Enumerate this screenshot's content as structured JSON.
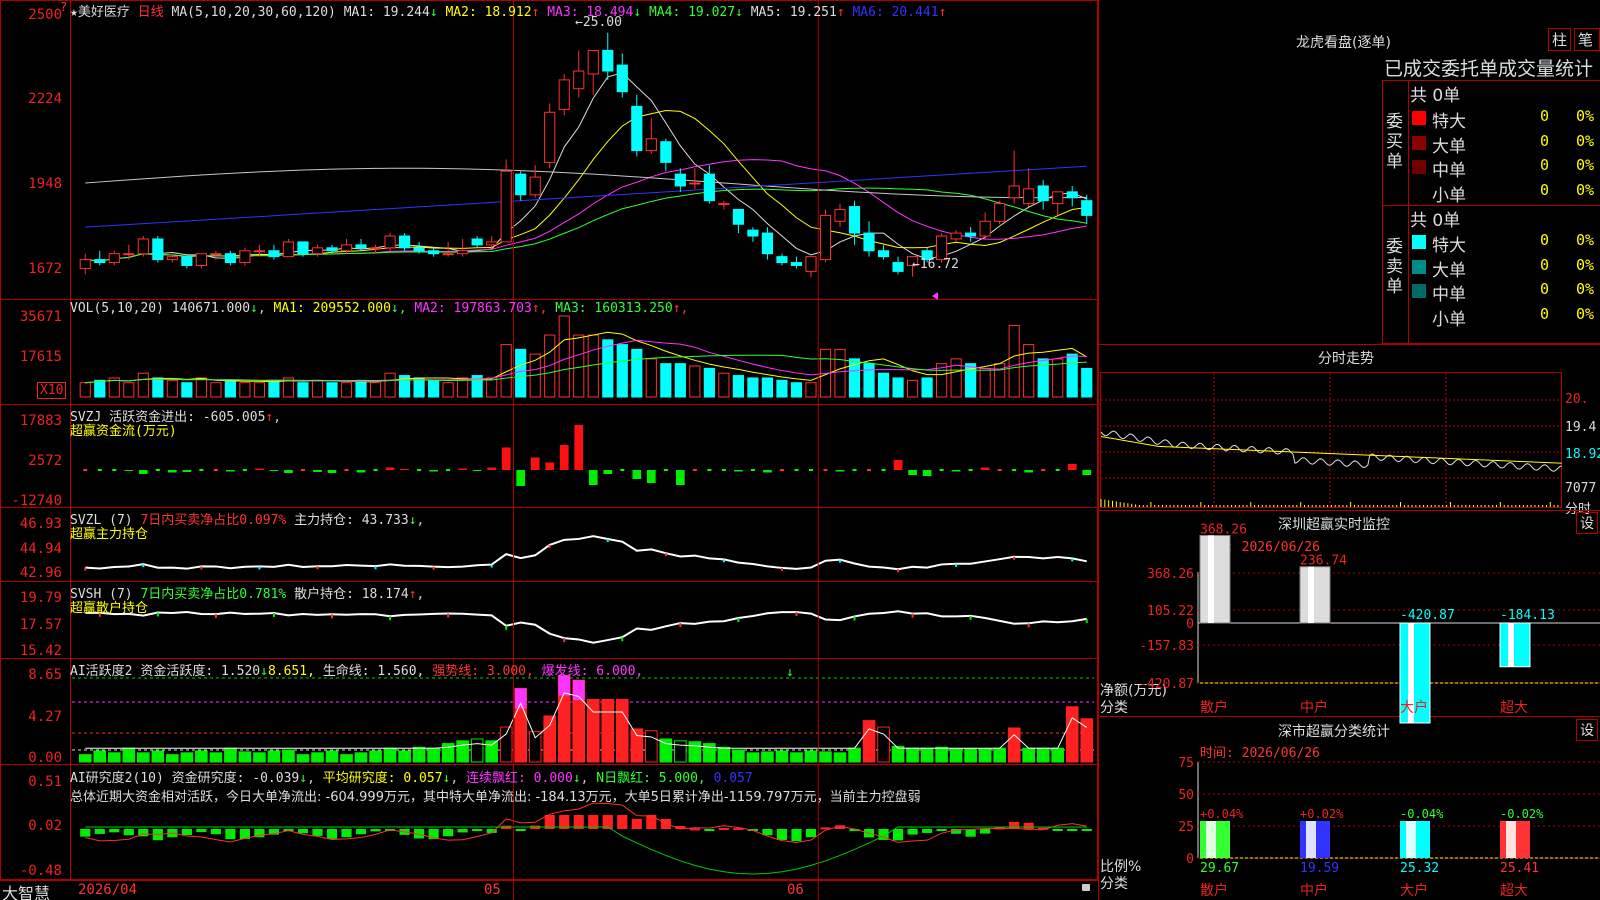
{
  "stock": {
    "name": "美好医疗",
    "period": "日线"
  },
  "main": {
    "ma_header": "MA(5,10,20,30,60,120)",
    "ma": [
      {
        "label": "MA1: 19.244",
        "arrow": "↓",
        "color": "#dddddd"
      },
      {
        "label": "MA2: 18.912",
        "arrow": "↑",
        "color": "#ffff00"
      },
      {
        "label": "MA3: 18.494",
        "arrow": "↓",
        "color": "#ff33ff"
      },
      {
        "label": "MA4: 19.027",
        "arrow": "↓",
        "color": "#33ff33"
      },
      {
        "label": "MA5: 19.251",
        "arrow": "↑",
        "color": "#dddddd"
      },
      {
        "label": "MA6: 20.441",
        "arrow": "↑",
        "color": "#3333ff"
      }
    ],
    "yticks": [
      "2500",
      "2224",
      "1948",
      "1672"
    ],
    "high_label": "25.00",
    "low_label": "16.72",
    "range": [
      16.2,
      25.5
    ],
    "candles": [
      [
        17.0,
        17.5,
        16.8,
        17.3
      ],
      [
        17.3,
        17.6,
        17.1,
        17.2
      ],
      [
        17.2,
        17.6,
        17.1,
        17.5
      ],
      [
        17.5,
        17.8,
        17.3,
        17.5
      ],
      [
        17.5,
        18.1,
        17.4,
        18.0
      ],
      [
        18.0,
        18.1,
        17.2,
        17.3
      ],
      [
        17.3,
        17.5,
        17.2,
        17.4
      ],
      [
        17.4,
        17.4,
        17.0,
        17.1
      ],
      [
        17.1,
        17.5,
        17.0,
        17.5
      ],
      [
        17.5,
        17.6,
        17.3,
        17.5
      ],
      [
        17.5,
        17.6,
        17.1,
        17.2
      ],
      [
        17.2,
        17.7,
        17.1,
        17.6
      ],
      [
        17.6,
        17.8,
        17.4,
        17.6
      ],
      [
        17.6,
        17.8,
        17.3,
        17.4
      ],
      [
        17.4,
        18.0,
        17.4,
        17.9
      ],
      [
        17.9,
        17.9,
        17.4,
        17.5
      ],
      [
        17.5,
        17.8,
        17.4,
        17.7
      ],
      [
        17.7,
        17.8,
        17.5,
        17.6
      ],
      [
        17.6,
        18.0,
        17.5,
        17.8
      ],
      [
        17.8,
        18.0,
        17.6,
        17.7
      ],
      [
        17.7,
        17.8,
        17.5,
        17.7
      ],
      [
        17.7,
        18.2,
        17.6,
        18.1
      ],
      [
        18.1,
        18.2,
        17.6,
        17.7
      ],
      [
        17.7,
        17.9,
        17.5,
        17.6
      ],
      [
        17.6,
        17.7,
        17.4,
        17.5
      ],
      [
        17.5,
        17.9,
        17.4,
        17.5
      ],
      [
        17.5,
        18.0,
        17.4,
        17.6
      ],
      [
        18.0,
        18.1,
        17.7,
        17.8
      ],
      [
        17.8,
        18.1,
        17.7,
        17.9
      ],
      [
        17.9,
        20.7,
        17.9,
        20.3
      ],
      [
        20.2,
        20.3,
        19.3,
        19.5
      ],
      [
        19.5,
        20.5,
        19.4,
        20.1
      ],
      [
        20.6,
        22.6,
        20.4,
        22.3
      ],
      [
        22.4,
        23.6,
        22.2,
        23.4
      ],
      [
        23.1,
        24.4,
        22.8,
        23.7
      ],
      [
        23.6,
        24.4,
        22.9,
        24.4
      ],
      [
        24.4,
        25.0,
        23.4,
        23.7
      ],
      [
        23.9,
        24.3,
        22.8,
        23.0
      ],
      [
        22.5,
        22.9,
        20.8,
        21.0
      ],
      [
        21.0,
        22.1,
        20.9,
        21.4
      ],
      [
        21.3,
        21.4,
        20.3,
        20.6
      ],
      [
        20.2,
        20.4,
        19.6,
        19.8
      ],
      [
        19.9,
        20.4,
        19.7,
        19.9
      ],
      [
        20.2,
        20.5,
        19.2,
        19.3
      ],
      [
        19.2,
        19.3,
        19.0,
        19.2
      ],
      [
        19.0,
        19.0,
        18.2,
        18.5
      ],
      [
        18.3,
        18.4,
        17.9,
        18.1
      ],
      [
        18.2,
        18.4,
        17.3,
        17.5
      ],
      [
        17.4,
        17.5,
        17.1,
        17.2
      ],
      [
        17.2,
        17.4,
        17.0,
        17.1
      ],
      [
        16.9,
        17.4,
        16.7,
        17.4
      ],
      [
        17.3,
        19.0,
        17.2,
        18.8
      ],
      [
        18.6,
        19.2,
        18.4,
        19.0
      ],
      [
        19.1,
        19.3,
        17.8,
        18.2
      ],
      [
        18.2,
        18.6,
        17.4,
        17.6
      ],
      [
        17.6,
        17.8,
        17.3,
        17.4
      ],
      [
        17.2,
        17.4,
        16.8,
        16.9
      ],
      [
        17.1,
        17.4,
        16.72,
        17.4
      ],
      [
        17.6,
        17.7,
        17.2,
        17.3
      ],
      [
        17.3,
        18.2,
        17.2,
        18.1
      ],
      [
        18.0,
        18.3,
        17.9,
        18.2
      ],
      [
        18.2,
        18.4,
        17.9,
        18.1
      ],
      [
        18.1,
        18.9,
        18.0,
        18.6
      ],
      [
        18.6,
        19.3,
        18.5,
        19.2
      ],
      [
        19.4,
        21.0,
        19.2,
        19.8
      ],
      [
        19.2,
        20.4,
        19.1,
        19.7
      ],
      [
        19.8,
        20.0,
        19.0,
        19.3
      ],
      [
        19.2,
        19.6,
        18.8,
        19.6
      ],
      [
        19.6,
        19.8,
        19.1,
        19.4
      ],
      [
        19.3,
        19.5,
        18.5,
        18.8
      ]
    ]
  },
  "vol": {
    "header": "VOL(5,10,20)",
    "value": "140671.000",
    "arrow": "↓",
    "ma": [
      {
        "label": "MA1: 209552.000",
        "arrow": "↓",
        "color": "#ffff00"
      },
      {
        "label": "MA2: 197863.703",
        "arrow": "↑",
        "color": "#ff33ff"
      },
      {
        "label": "MA3: 160313.250",
        "arrow": "↑",
        "color": "#33ff33"
      }
    ],
    "yticks": [
      "35671",
      "17615"
    ],
    "unit": "X10",
    "values": [
      0.3,
      0.35,
      0.4,
      0.3,
      0.5,
      0.4,
      0.35,
      0.3,
      0.4,
      0.3,
      0.35,
      0.3,
      0.3,
      0.35,
      0.4,
      0.3,
      0.35,
      0.3,
      0.3,
      0.35,
      0.3,
      0.5,
      0.45,
      0.4,
      0.35,
      0.3,
      0.4,
      0.45,
      0.4,
      1.1,
      1.0,
      0.9,
      1.3,
      1.7,
      1.3,
      1.3,
      1.2,
      1.1,
      1.0,
      0.8,
      0.7,
      0.7,
      0.65,
      0.6,
      0.5,
      0.45,
      0.4,
      0.4,
      0.35,
      0.3,
      0.3,
      1.0,
      1.0,
      0.8,
      0.7,
      0.5,
      0.4,
      0.35,
      0.4,
      0.7,
      0.8,
      0.7,
      0.6,
      0.7,
      1.5,
      1.1,
      0.8,
      0.8,
      0.9,
      0.6
    ]
  },
  "svzj": {
    "name": "SVZJ",
    "label": "活跃资金进出: -605.005",
    "arrow": "↑",
    "sub": "超赢资金流(万元)",
    "yticks": [
      "17883",
      "2572",
      "-12740"
    ],
    "values": [
      0,
      0,
      0,
      -0.2,
      -0.8,
      0,
      -0.5,
      -0.4,
      0,
      0,
      -0.3,
      0,
      0.3,
      -0.2,
      -0.6,
      0,
      -0.4,
      -0.6,
      0,
      -0.5,
      0,
      0.5,
      0.2,
      0,
      -0.3,
      0,
      0.3,
      -0.2,
      0.5,
      4.5,
      -3.2,
      2.5,
      1.5,
      5.0,
      9.0,
      -3.0,
      -0.8,
      0,
      -1.8,
      -2.6,
      0,
      -3.0,
      0,
      0,
      0,
      -0.3,
      0,
      -0.5,
      0,
      0,
      0,
      0,
      -0.3,
      0,
      0,
      0,
      2.0,
      -1.0,
      -1.2,
      0,
      -0.3,
      0,
      0.5,
      0,
      0,
      -0.5,
      0,
      0,
      1.2,
      -1.0,
      0,
      1.6,
      -0.7,
      0
    ]
  },
  "svzl": {
    "name": "SVZL",
    "param": "(7)",
    "label": "7日内买卖净占比0.097%",
    "hold": "主力持仓: 43.733",
    "arrow": "↓",
    "sub": "超赢主力持仓",
    "yticks": [
      "46.93",
      "44.94",
      "42.96"
    ]
  },
  "svsh": {
    "name": "SVSH",
    "param": "(7)",
    "label": "7日内买卖净占比0.781%",
    "hold": "散户持仓: 18.174",
    "arrow": "↑",
    "sub": "超赢散户持仓",
    "yticks": [
      "19.79",
      "17.57",
      "15.42"
    ]
  },
  "ai1": {
    "name": "AI活跃度2",
    "l1": "资金活跃度: 1.520",
    "a1": "↓",
    "v2": "8.651,",
    "l3": "生命线: 1.560,",
    "l4": "强势线: 3.000,",
    "l5": "爆发线: 6.000,",
    "yticks": [
      "8.65",
      "4.27",
      "0.00"
    ],
    "values": [
      0.8,
      1.2,
      1.0,
      1.5,
      1.0,
      1.2,
      0.8,
      1.0,
      1.2,
      1.0,
      1.5,
      1.1,
      1.0,
      1.2,
      1.3,
      0.8,
      1.0,
      1.2,
      0.8,
      1.0,
      1.2,
      1.5,
      1.2,
      1.6,
      1.5,
      2.0,
      2.3,
      2.5,
      2.3,
      3.8,
      8.0,
      3.3,
      5.0,
      9.4,
      8.9,
      6.8,
      6.8,
      6.8,
      3.6,
      3.4,
      2.5,
      2.3,
      2.2,
      2.0,
      1.6,
      1.3,
      1.0,
      1.1,
      1.2,
      1.0,
      1.2,
      1.1,
      1.0,
      1.5,
      4.5,
      3.8,
      1.7,
      1.5,
      1.5,
      1.6,
      1.4,
      1.4,
      1.4,
      1.5,
      3.7,
      1.5,
      1.5,
      1.5,
      6.0,
      4.7,
      2.0,
      4.0,
      3.8,
      1.5
    ]
  },
  "ai2": {
    "name": "AI研究度2(10)",
    "l1": "资金研究度: -0.039",
    "a1": "↓",
    "l2": "平均研究度: 0.057",
    "a2": "↓",
    "l3": "连续飘红: 0.000",
    "a3": "↓",
    "l4": "N日飘红: 5.000,",
    "l5": "0.057",
    "yticks": [
      "0.51",
      "0.02",
      "-0.48"
    ],
    "summary": "总体近期大资金相对活跃，今日大单净流出: -604.999万元，其中特大单净流出: -184.13万元，大单5日累计净出-1159.797万元，当前主力控盘弱"
  },
  "xaxis": {
    "labels": [
      "2026/04",
      "05",
      "06"
    ],
    "app": "大智慧"
  },
  "right": {
    "lhb_title": "龙虎看盘(逐单)",
    "btn1": "柱",
    "btn2": "笔",
    "tabs": "已成交委托单成交量统计",
    "buy_side": "委买单",
    "sell_side": "委卖单",
    "buy_total": "共 0单",
    "sell_total": "共 0单",
    "buy_rows": [
      {
        "label": "特大",
        "v": "0",
        "p": "0%",
        "color": "#ff0000"
      },
      {
        "label": "大单",
        "v": "0",
        "p": "0%",
        "color": "#8b0000"
      },
      {
        "label": "中单",
        "v": "0",
        "p": "0%",
        "color": "#700000"
      },
      {
        "label": "小单",
        "v": "0",
        "p": "0%",
        "color": ""
      }
    ],
    "sell_rows": [
      {
        "label": "特大",
        "v": "0",
        "p": "0%",
        "color": "#00ffff"
      },
      {
        "label": "大单",
        "v": "0",
        "p": "0%",
        "color": "#008b8b"
      },
      {
        "label": "中单",
        "v": "0",
        "p": "0%",
        "color": "#006a6a"
      },
      {
        "label": "小单",
        "v": "0",
        "p": "0%",
        "color": ""
      }
    ],
    "intraday_title": "分时走势",
    "intraday_ticks": [
      "20.",
      "19.4",
      "18.92",
      "7077",
      "分时"
    ],
    "monitor_title": "深圳超赢实时监控",
    "monitor_btn": "设",
    "monitor_time": "时间: 2026/06/26",
    "monitor_yticks": [
      "368.26",
      "105.22",
      "0",
      "-157.83",
      "-420.87"
    ],
    "monitor_ylabel": "净额(万元)",
    "monitor_xlabel": "分类",
    "monitor_bars": [
      {
        "name": "散户",
        "v": 368.26,
        "label": "368.26"
      },
      {
        "name": "中户",
        "v": 236.74,
        "label": "236.74"
      },
      {
        "name": "大户",
        "v": -420.87,
        "label": "-420.87"
      },
      {
        "name": "超大",
        "v": -184.13,
        "label": "-184.13"
      }
    ],
    "class_title": "深市超赢分类统计",
    "class_btn": "设",
    "class_time": "时间: 2026/06/26",
    "class_yticks": [
      "75",
      "50",
      "25",
      "0"
    ],
    "class_ylabel": "比例%",
    "class_xlabel": "分类",
    "class_bars": [
      {
        "name": "散户",
        "v": 29.67,
        "chg": "+0.04%",
        "label": "29.67",
        "color": "#33ff33"
      },
      {
        "name": "中户",
        "v": 19.59,
        "chg": "+0.02%",
        "label": "19.59",
        "color": "#3333ff"
      },
      {
        "name": "大户",
        "v": 25.32,
        "chg": "-0.04%",
        "label": "25.32",
        "color": "#00ffff"
      },
      {
        "name": "超大",
        "v": 25.41,
        "chg": "-0.02%",
        "label": "25.41",
        "color": "#ff3333"
      }
    ]
  }
}
